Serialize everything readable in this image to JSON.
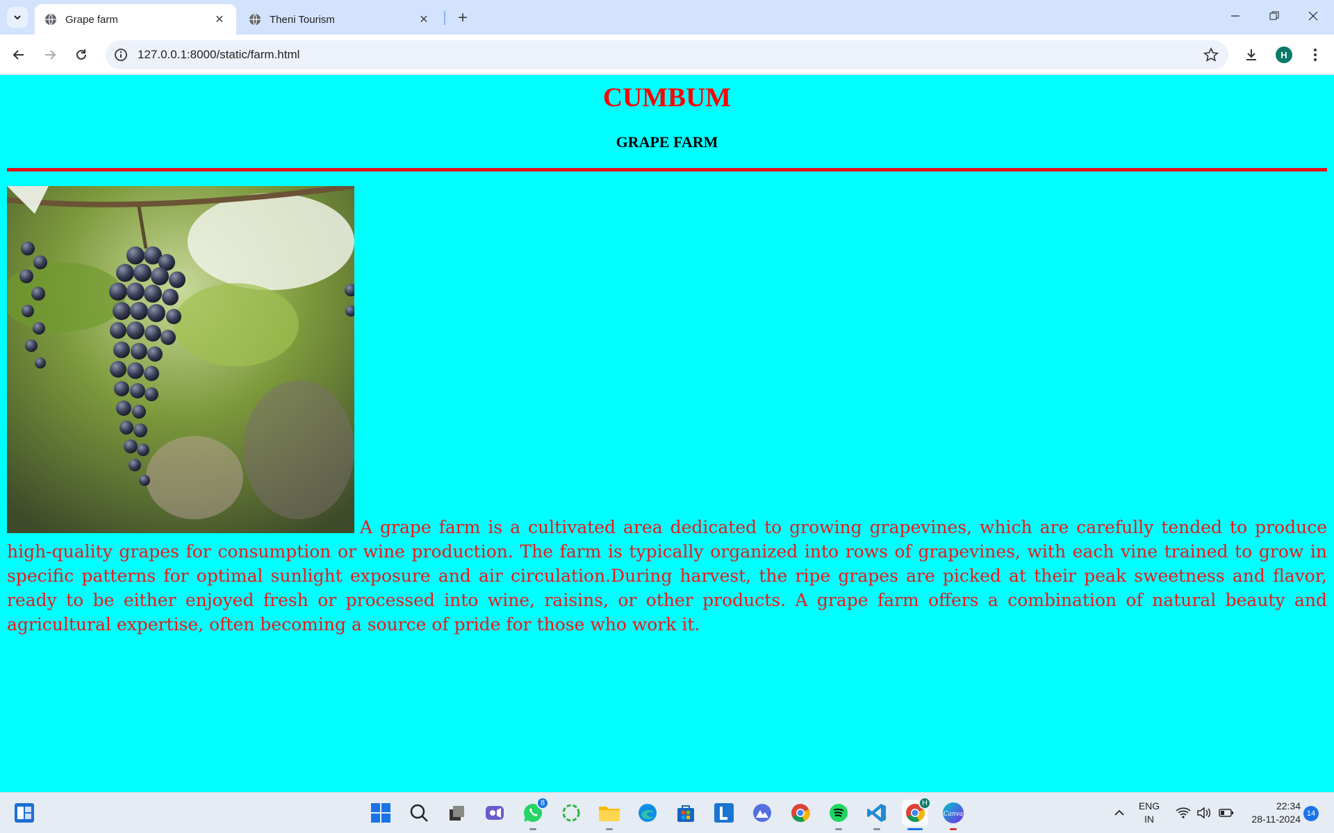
{
  "browser": {
    "tabs": [
      {
        "title": "Grape farm",
        "active": true
      },
      {
        "title": "Theni Tourism",
        "active": false
      }
    ],
    "url": "127.0.0.1:8000/static/farm.html",
    "profile_initial": "H"
  },
  "page": {
    "title": "CUMBUM",
    "subtitle": "GRAPE FARM",
    "paragraph": "A grape farm is a cultivated area dedicated to growing grapevines, which are carefully tended to produce high-quality grapes for consumption or wine production. The farm is typically organized into rows of grapevines, with each vine trained to grow in specific patterns for optimal sunlight exposure and air circulation.During harvest, the ripe grapes are picked at their peak sweetness and flavor, ready to be either enjoyed fresh or processed into wine, raisins, or other products. A grape farm offers a combination of natural beauty and agricultural expertise, often becoming a source of pride for those who work it.",
    "colors": {
      "background": "#00ffff",
      "title": "#ff0000",
      "text": "#e81a1a",
      "rule": "#e0141a"
    }
  },
  "taskbar": {
    "whatsapp_badge": "8",
    "chrome_profile_badge": "H",
    "language": "ENG",
    "region": "IN",
    "time": "22:34",
    "date": "28-11-2024",
    "notification_count": "14",
    "canva_label": "Canva"
  }
}
